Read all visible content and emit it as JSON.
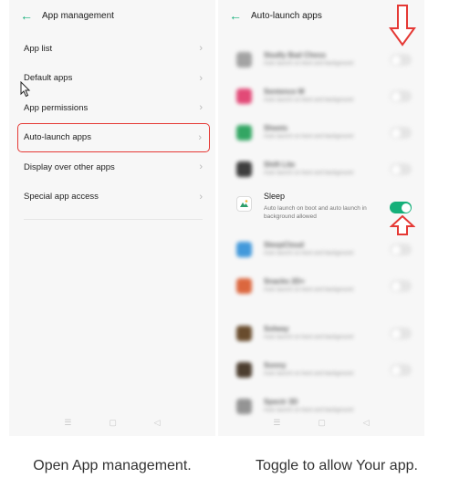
{
  "left_screen": {
    "title": "App management",
    "menu": [
      {
        "label": "App list"
      },
      {
        "label": "Default apps"
      },
      {
        "label": "App permissions"
      },
      {
        "label": "Auto-launch apps",
        "highlighted": true
      },
      {
        "label": "Display over other apps"
      },
      {
        "label": "Special app access"
      }
    ],
    "caption": "Open App management."
  },
  "right_screen": {
    "title": "Auto-launch apps",
    "apps_above": [
      {
        "name": "Studly Bad Chess",
        "desc": "Auto launch on boot and background",
        "icon_color": "#9a9a9a",
        "enabled": false
      },
      {
        "name": "Sentence M",
        "desc": "Auto launch on boot and background",
        "icon_color": "#e0386a",
        "enabled": false
      },
      {
        "name": "Sheets",
        "desc": "Auto launch on boot and background",
        "icon_color": "#1e9e54",
        "enabled": false
      },
      {
        "name": "Shift Lite",
        "desc": "Auto launch on boot and background",
        "icon_color": "#2a2a2a",
        "enabled": false
      }
    ],
    "sleep_app": {
      "name": "Sleep",
      "desc": "Auto launch on boot and auto launch in background allowed",
      "enabled": true
    },
    "apps_below": [
      {
        "name": "SleepCloud",
        "desc": "Auto launch on boot and background",
        "icon_color": "#2f8fd8",
        "enabled": false
      },
      {
        "name": "Snacks 2D+",
        "desc": "Auto launch on boot and background",
        "icon_color": "#d9582b",
        "enabled": false
      },
      {
        "name": "Solway",
        "desc": "Auto launch on boot and background",
        "icon_color": "#5a3a18",
        "enabled": false
      },
      {
        "name": "Sonny",
        "desc": "Auto launch on boot and background",
        "icon_color": "#3a2a1a",
        "enabled": false
      },
      {
        "name": "Spectr 3D",
        "desc": "Auto launch on boot and background",
        "icon_color": "#8a8a8a",
        "enabled": false
      }
    ],
    "caption": "Toggle to allow Your app."
  },
  "colors": {
    "accent": "#16b07a",
    "highlight_red": "#e53935"
  },
  "icons": {
    "back": "arrow-left-icon",
    "chevron": "chevron-right-icon",
    "nav": [
      "menu-icon",
      "home-icon",
      "back-triangle-icon"
    ]
  }
}
